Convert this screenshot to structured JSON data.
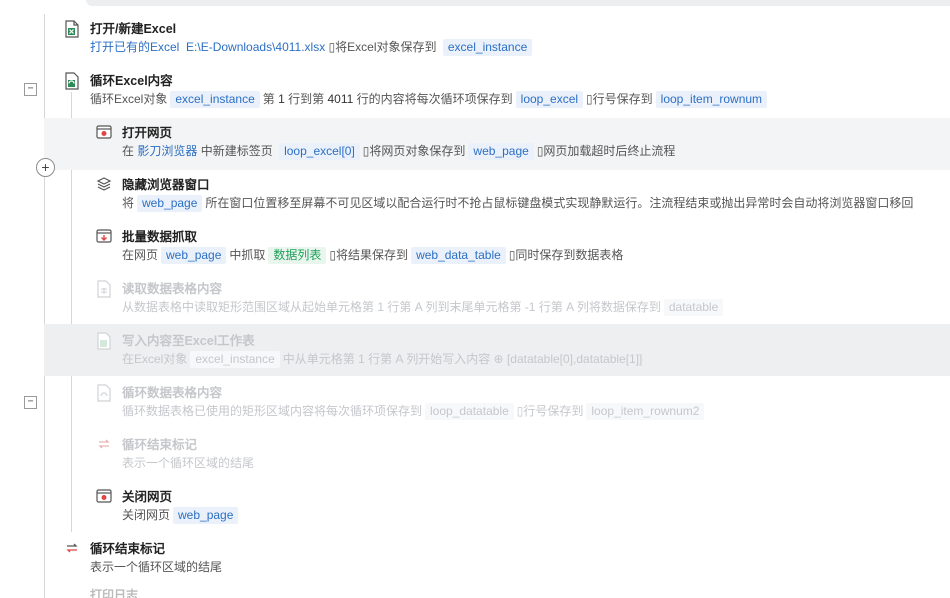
{
  "steps": [
    {
      "title": "打开/新建Excel",
      "icon": "excel-open-icon",
      "desc": {
        "a": "打开已有的Excel",
        "b": "E:\\E-Downloads\\4011.xlsx",
        "c": "将Excel对象保存到",
        "tag": "excel_instance"
      }
    },
    {
      "title": "循环Excel内容",
      "icon": "excel-loop-icon",
      "desc": {
        "a": "循环Excel对象",
        "tag1": "excel_instance",
        "b": "第",
        "n1": "1",
        "c": "行到第",
        "n2": "4011",
        "d": "行的内容将每次循环项保存到",
        "tag2": "loop_excel",
        "e": "行号保存到",
        "tag3": "loop_item_rownum"
      }
    },
    {
      "title": "打开网页",
      "icon": "browser-open-icon",
      "desc": {
        "a": "在",
        "b": "影刀浏览器",
        "c": "中新建标签页",
        "tag1": "loop_excel[0]",
        "d": "将网页对象保存到",
        "tag2": "web_page",
        "e": "网页加载超时后终止流程"
      }
    },
    {
      "title": "隐藏浏览器窗口",
      "icon": "layers-icon",
      "desc": {
        "a": "将",
        "tag": "web_page",
        "b": "所在窗口位置移至屏幕不可见区域以配合运行时不抢占鼠标键盘模式实现静默运行。注流程结束或抛出异常时会自动将浏览器窗口移回"
      }
    },
    {
      "title": "批量数据抓取",
      "icon": "data-scrape-icon",
      "desc": {
        "a": "在网页",
        "tag1": "web_page",
        "b": "中抓取",
        "tag2": "数据列表",
        "c": "将结果保存到",
        "tag3": "web_data_table",
        "d": "同时保存到数据表格"
      }
    },
    {
      "title": "读取数据表格内容",
      "icon": "table-read-icon",
      "desc": {
        "a": "从数据表格中读取矩形范围区域从起始单元格第",
        "n1": "1",
        "b": "行第",
        "n2": "A",
        "c": "列到末尾单元格第",
        "n3": "-1",
        "d": "行第",
        "n4": "A",
        "e": "列将数据保存到",
        "tag": "datatable"
      }
    },
    {
      "title": "写入内容至Excel工作表",
      "icon": "excel-write-icon",
      "desc": {
        "a": "在Excel对象",
        "tag": "excel_instance",
        "b": "中从单元格第",
        "n1": "1",
        "c": "行第",
        "n2": "A",
        "d": "列开始写入内容",
        "e": "[datatable[0],datatable[1]]"
      }
    },
    {
      "title": "循环数据表格内容",
      "icon": "table-loop-icon",
      "desc": {
        "a": "循环数据表格已使用的矩形区域内容将每次循环项保存到",
        "tag1": "loop_datatable",
        "b": "行号保存到",
        "tag2": "loop_item_rownum2"
      }
    },
    {
      "title": "循环结束标记",
      "icon": "loop-end-icon",
      "desc": {
        "a": "表示一个循环区域的结尾"
      }
    },
    {
      "title": "关闭网页",
      "icon": "browser-close-icon",
      "desc": {
        "a": "关闭网页",
        "tag": "web_page"
      }
    },
    {
      "title": "循环结束标记",
      "icon": "loop-end-icon",
      "desc": {
        "a": "表示一个循环区域的结尾"
      }
    }
  ],
  "partial_next_title": "打印日志",
  "toggles": {
    "collapse": "−",
    "add": "+"
  }
}
